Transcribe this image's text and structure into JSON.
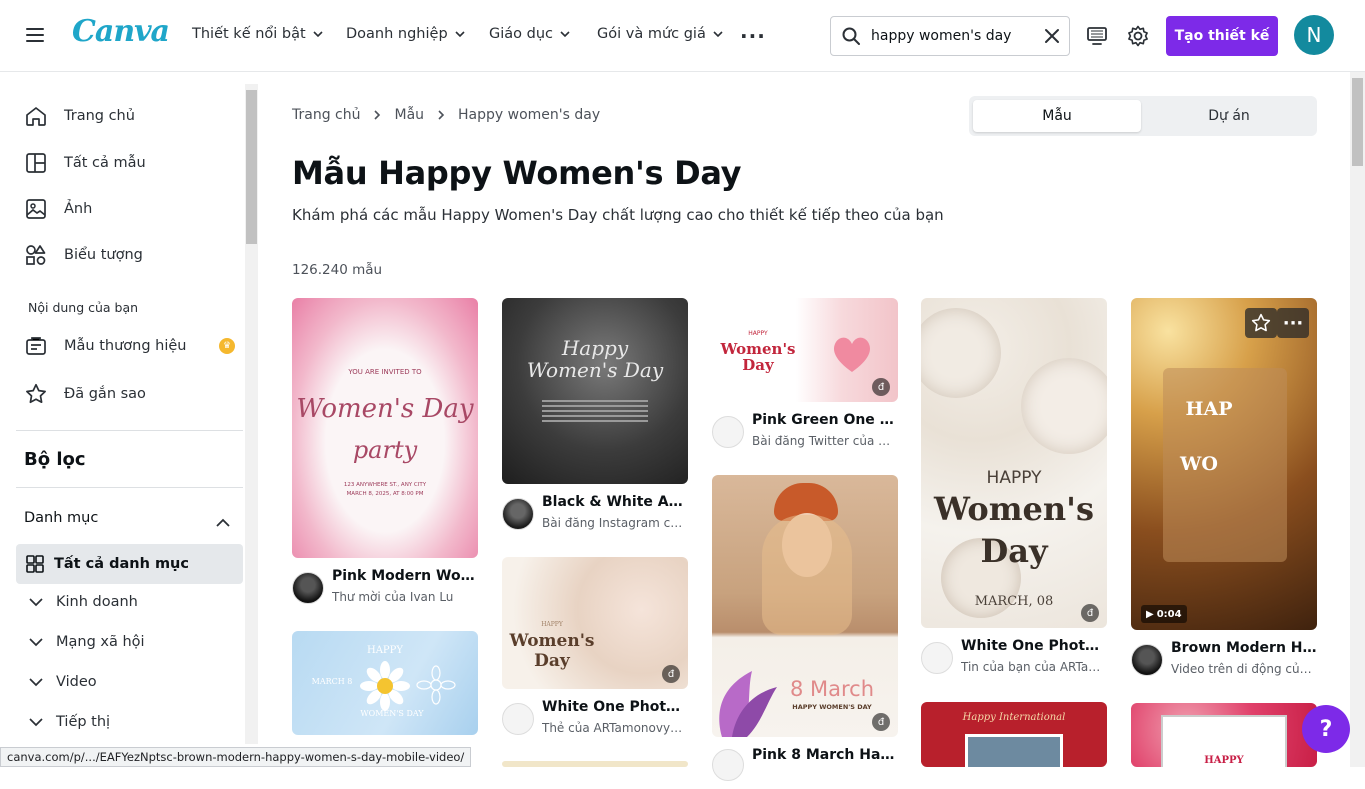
{
  "header": {
    "logo": "Canva",
    "nav": [
      "Thiết kế nổi bật",
      "Doanh nghiệp",
      "Giáo dục",
      "Gói và mức giá"
    ],
    "search_value": "happy women's day",
    "create_button": "Tạo thiết kế",
    "avatar_initial": "N"
  },
  "sidebar": {
    "items": [
      "Trang chủ",
      "Tất cả mẫu",
      "Ảnh",
      "Biểu tượng"
    ],
    "section_label": "Nội dung của bạn",
    "content_items": [
      "Mẫu thương hiệu",
      "Đã gắn sao"
    ],
    "filter_title": "Bộ lọc",
    "category_label": "Danh mục",
    "all_categories": "Tất cả danh mục",
    "subcategories": [
      "Kinh doanh",
      "Mạng xã hội",
      "Video",
      "Tiếp thị"
    ]
  },
  "breadcrumb": [
    "Trang chủ",
    "Mẫu",
    "Happy women's day"
  ],
  "toggle": {
    "active": "Mẫu",
    "inactive": "Dự án"
  },
  "main": {
    "title": "Mẫu Happy Women's Day",
    "subtitle": "Khám phá các mẫu Happy Women's Day chất lượng cao cho thiết kế tiếp theo của bạn",
    "count": "126.240 mẫu"
  },
  "cards": [
    {
      "title": "Pink Modern Wome...",
      "subtitle": "Thư mời của Ivan Lu",
      "overlay": [
        "YOU ARE INVITED TO",
        "Women's Day",
        "party",
        "123 ANYWHERE ST., ANY CITY",
        "MARCH 8, 2025, AT 8:00 PM"
      ]
    },
    {
      "title": "Black & White Aest...",
      "subtitle": "Bài đăng Instagram của...",
      "overlay": [
        "Happy",
        "Women's Day"
      ]
    },
    {
      "title": "Pink Green One Ph...",
      "subtitle": "Bài đăng Twitter của AR...",
      "overlay": [
        "HAPPY",
        "Women's",
        "Day"
      ]
    },
    {
      "title": "White One Photo R...",
      "subtitle": "Tin của bạn của ARTam...",
      "overlay": [
        "HAPPY",
        "Women's",
        "Day",
        "MARCH, 08"
      ]
    },
    {
      "title": "Brown Modern Hap...",
      "subtitle": "Video trên di động của I...",
      "overlay": [
        "HAP",
        "WO"
      ],
      "duration": "0:04"
    },
    {
      "title": "White One Photo R...",
      "subtitle": "Thẻ của ARTamonovy_S...",
      "overlay": [
        "HAPPY",
        "Women's",
        "Day"
      ]
    },
    {
      "title": "Pink 8 March Happ...",
      "subtitle": "",
      "overlay": [
        "8 March",
        "HAPPY WOMEN'S DAY"
      ]
    },
    {
      "title": "",
      "subtitle": "",
      "overlay": [
        "HAPPY",
        "MARCH 8",
        "WOMEN'S DAY"
      ]
    },
    {
      "title": "",
      "subtitle": "",
      "overlay": [
        "Happy International"
      ]
    },
    {
      "title": "",
      "subtitle": "",
      "overlay": [
        "HAPPY"
      ]
    }
  ],
  "status_url": "canva.com/p/.../EAFYezNptsc-brown-modern-happy-women-s-day-mobile-video/",
  "help": "?"
}
